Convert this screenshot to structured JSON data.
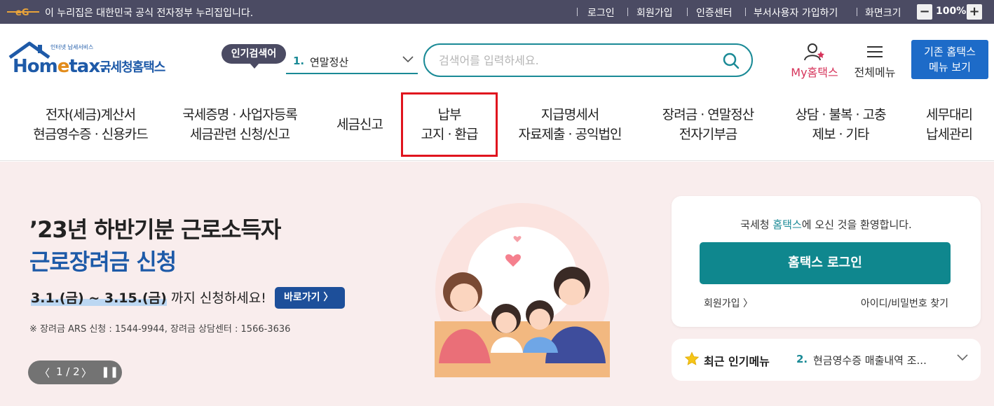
{
  "gov_bar": {
    "notice": "이 누리집은 대한민국 공식 전자정부 누리집입니다.",
    "login": "로그인",
    "join": "회원가입",
    "cert": "인증센터",
    "dept_join": "부서사용자 가입하기",
    "screen_size": "화면크기",
    "zoom_out": "−",
    "zoom_value": "100%",
    "zoom_in": "+"
  },
  "header": {
    "logo_brand_1": "Hom",
    "logo_brand_e": "e",
    "logo_brand_2": "tax.",
    "logo_tagline": "인터넷 납세서비스",
    "logo_name": "국세청홈택스",
    "popular_label": "인기검색어",
    "popular_rank": "1.",
    "popular_keyword": "연말정산",
    "search_placeholder": "검색어를 입력하세요.",
    "my_label": "My홈택스",
    "allmenu_label": "전체메뉴",
    "old_menu_line1": "기존 홈택스",
    "old_menu_line2": "메뉴 보기"
  },
  "gnb": [
    {
      "line1": "전자(세금)계산서",
      "line2": "현금영수증 · 신용카드"
    },
    {
      "line1": "국세증명 · 사업자등록",
      "line2": "세금관련 신청/신고"
    },
    {
      "line1": "세금신고",
      "line2": ""
    },
    {
      "line1": "납부",
      "line2": "고지 · 환급"
    },
    {
      "line1": "지급명세서",
      "line2": "자료제출 · 공익법인"
    },
    {
      "line1": "장려금 · 연말정산",
      "line2": "전자기부금"
    },
    {
      "line1": "상담 · 불복 · 고충",
      "line2": "제보 · 기타"
    },
    {
      "line1": "세무대리",
      "line2": "납세관리"
    }
  ],
  "hero": {
    "title1": "’23년 하반기분 근로소득자",
    "title2": "근로장려금 신청",
    "date": "3.1.(금) ~ 3.15.(금)",
    "date_rest": " 까지 신청하세요!",
    "go_button": "바로가기 〉",
    "note": "※ 장려금 ARS 신청 : 1544-9944, 장려금 상담센터 : 1566-3636",
    "pager_prev": "〈",
    "pager_count": "1 / 2",
    "pager_next": "〉",
    "pager_pause": "❚❚"
  },
  "login_card": {
    "welcome_pre": "국세청 ",
    "welcome_brand": "홈택스",
    "welcome_post": "에 오신 것을 환영합니다.",
    "login_button": "홈택스 로그인",
    "join_link": "회원가입 〉",
    "find_link": "아이디/비밀번호 찾기"
  },
  "recent": {
    "title": "최근 인기메뉴",
    "rank": "2.",
    "item": "현금영수증 매출내역 조..."
  },
  "colors": {
    "gov_bar": "#4b4b63",
    "teal": "#1a8a96",
    "brand_blue": "#1d5aa8",
    "highlight_red": "#e0141e",
    "hero_bg": "#f9eded"
  }
}
